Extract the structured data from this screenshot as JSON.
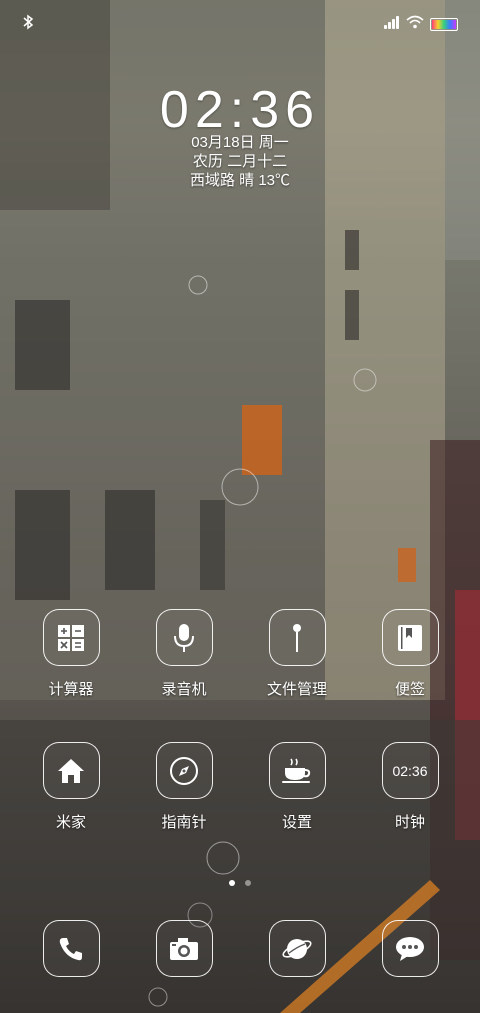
{
  "status_bar": {
    "bluetooth_icon": "bluetooth-icon",
    "signal_icon": "signal-icon",
    "wifi_icon": "wifi-icon",
    "battery_icon": "battery-icon"
  },
  "lockscreen": {
    "time": "02:36",
    "date_line": "03月18日 周一",
    "lunar_line": "农历 二月十二",
    "weather_line": "西域路 晴 13℃"
  },
  "apps": [
    {
      "label": "计算器",
      "icon": "calculator-icon"
    },
    {
      "label": "录音机",
      "icon": "microphone-icon"
    },
    {
      "label": "文件管理",
      "icon": "file-manager-icon"
    },
    {
      "label": "便签",
      "icon": "notes-icon"
    },
    {
      "label": "米家",
      "icon": "home-icon"
    },
    {
      "label": "指南针",
      "icon": "compass-icon"
    },
    {
      "label": "设置",
      "icon": "settings-cup-icon"
    },
    {
      "label": "时钟",
      "icon": "clock-icon",
      "icon_text": "02:36"
    }
  ],
  "dock": [
    {
      "icon": "phone-icon"
    },
    {
      "icon": "camera-icon"
    },
    {
      "icon": "browser-icon"
    },
    {
      "icon": "messages-icon"
    }
  ],
  "page_indicator": {
    "pages": 2,
    "current": 1
  }
}
